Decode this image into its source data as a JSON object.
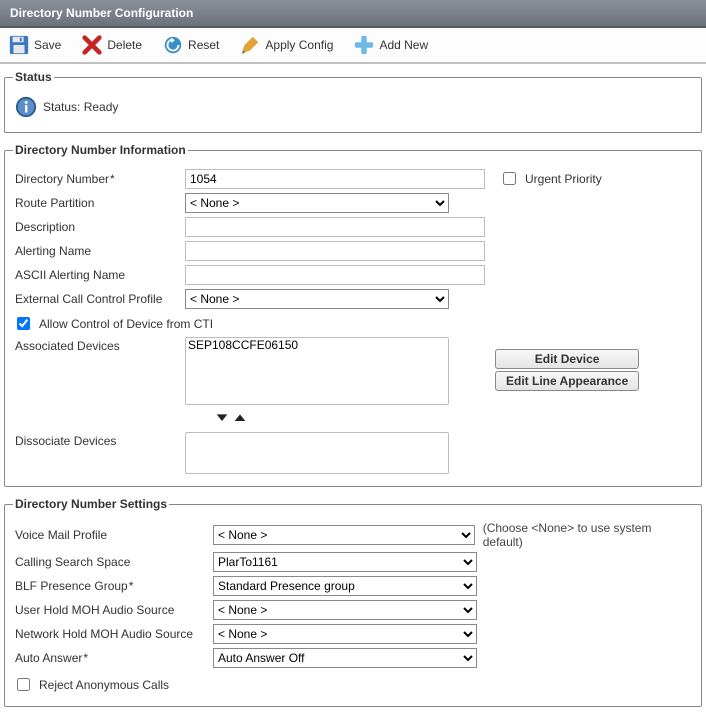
{
  "title": "Directory Number Configuration",
  "toolbar": {
    "save": "Save",
    "delete": "Delete",
    "reset": "Reset",
    "apply": "Apply Config",
    "addnew": "Add New"
  },
  "status": {
    "legend": "Status",
    "text": "Status: Ready"
  },
  "dni": {
    "legend": "Directory Number Information",
    "labels": {
      "directoryNumber": "Directory Number",
      "routePartition": "Route Partition",
      "description": "Description",
      "alertingName": "Alerting Name",
      "asciiAlertingName": "ASCII Alerting Name",
      "externalCallControl": "External Call Control Profile",
      "urgentPriority": "Urgent Priority",
      "allowCti": "Allow Control of Device from CTI",
      "associatedDevices": "Associated Devices",
      "dissociateDevices": "Dissociate Devices"
    },
    "values": {
      "directoryNumber": "1054",
      "routePartition": "< None >",
      "description": "",
      "alertingName": "",
      "asciiAlertingName": "",
      "externalCallControl": "< None >",
      "associatedDevices": [
        "SEP108CCFE06150"
      ]
    },
    "buttons": {
      "editDevice": "Edit Device",
      "editLineAppearance": "Edit Line Appearance"
    }
  },
  "dns": {
    "legend": "Directory Number Settings",
    "labels": {
      "voiceMailProfile": "Voice Mail Profile",
      "callingSearchSpace": "Calling Search Space",
      "blfPresenceGroup": "BLF Presence Group",
      "userHoldMoh": "User Hold MOH Audio Source",
      "networkHoldMoh": "Network Hold MOH Audio Source",
      "autoAnswer": "Auto Answer",
      "rejectAnon": "Reject Anonymous Calls"
    },
    "values": {
      "voiceMailProfile": "< None >",
      "callingSearchSpace": "PlarTo1161",
      "blfPresenceGroup": "Standard Presence group",
      "userHoldMoh": "< None >",
      "networkHoldMoh": "< None >",
      "autoAnswer": "Auto Answer Off"
    },
    "hints": {
      "voiceMailProfile": "(Choose <None> to use system default)"
    }
  }
}
